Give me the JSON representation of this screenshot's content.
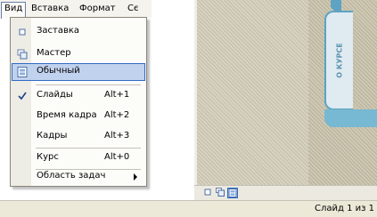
{
  "menubar": {
    "items": [
      {
        "label": "Вид"
      },
      {
        "label": "Вставка"
      },
      {
        "label": "Формат"
      },
      {
        "label": "Сє"
      }
    ]
  },
  "view_menu": {
    "items": [
      {
        "label": "Заставка",
        "icon": "slide-sorter-icon",
        "shortcut": ""
      },
      {
        "label": "Мастер",
        "icon": "master-view-icon",
        "shortcut": ""
      },
      {
        "label": "Обычный",
        "icon": "normal-view-icon",
        "shortcut": "",
        "highlighted": true
      },
      {
        "label": "Слайды",
        "icon": "check-icon",
        "shortcut": "Alt+1",
        "checked": true
      },
      {
        "label": "Время кадра",
        "icon": "",
        "shortcut": "Alt+2"
      },
      {
        "label": "Кадры",
        "icon": "",
        "shortcut": "Alt+3"
      },
      {
        "label": "Курс",
        "icon": "",
        "shortcut": "Alt+0"
      },
      {
        "label": "Область задач",
        "icon": "submenu-arrow-icon",
        "shortcut": ""
      }
    ]
  },
  "slide_tab": {
    "label": "О КУРСЕ"
  },
  "statusbar": {
    "text": "Слайд 1 из 1"
  },
  "colors": {
    "highlight_bg": "#c1d2ee",
    "highlight_border": "#316ac5",
    "tab_accent": "#5ea3c1"
  }
}
